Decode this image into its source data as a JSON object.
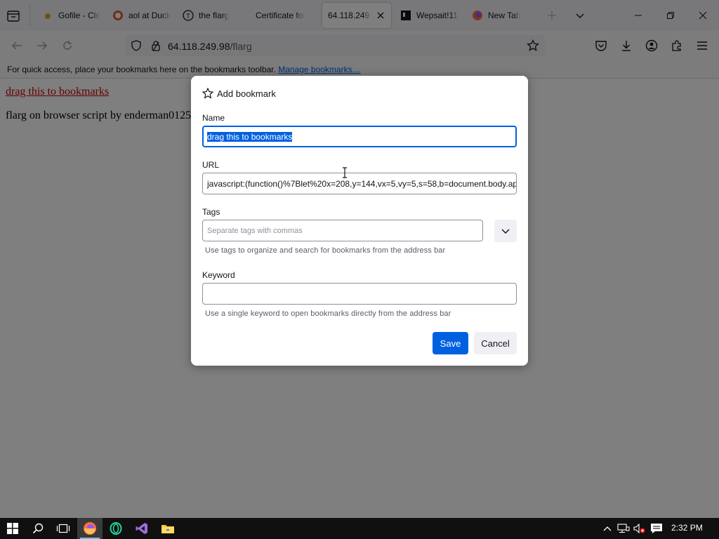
{
  "tabs": [
    {
      "label": "Gofile - Clo",
      "icon": "gofile-icon",
      "active": false
    },
    {
      "label": "aol at Duck",
      "icon": "duckduckgo-icon",
      "active": false
    },
    {
      "label": "the flarg",
      "icon": "site-t-icon",
      "active": false
    },
    {
      "label": "Certificate for",
      "icon": "none",
      "active": false
    },
    {
      "label": "64.118.249.98",
      "icon": "none",
      "active": true
    },
    {
      "label": "Wepsait!11!",
      "icon": "site-w-icon",
      "active": false
    },
    {
      "label": "New Tab",
      "icon": "firefox-icon",
      "active": false
    }
  ],
  "urlbar": {
    "host": "64.118.249.98",
    "path": "/flarg"
  },
  "bookmarks_toolbar": {
    "message": "For quick access, place your bookmarks here on the bookmarks toolbar.",
    "manage_link": "Manage bookmarks…"
  },
  "page": {
    "link_text": "drag this to bookmarks",
    "body_text": "flarg on browser script by enderman0125"
  },
  "dialog": {
    "title": "Add bookmark",
    "name_label": "Name",
    "name_value": "drag this to bookmarks",
    "url_label": "URL",
    "url_value": "javascript:(function()%7Blet%20x=208,y=144,vx=5,vy=5,s=58,b=document.body.ap",
    "tags_label": "Tags",
    "tags_placeholder": "Separate tags with commas",
    "tags_helper": "Use tags to organize and search for bookmarks from the address bar",
    "keyword_label": "Keyword",
    "keyword_value": "",
    "keyword_helper": "Use a single keyword to open bookmarks directly from the address bar",
    "save_label": "Save",
    "cancel_label": "Cancel"
  },
  "taskbar": {
    "apps": [
      "windows-start-icon",
      "search-icon",
      "task-view-icon",
      "firefox-icon",
      "opera-gx-icon",
      "visual-studio-icon",
      "file-explorer-icon"
    ],
    "clock": "2:32 PM"
  },
  "colors": {
    "accent": "#0061e0",
    "page_link": "#cc0000",
    "taskbar": "#101010"
  }
}
